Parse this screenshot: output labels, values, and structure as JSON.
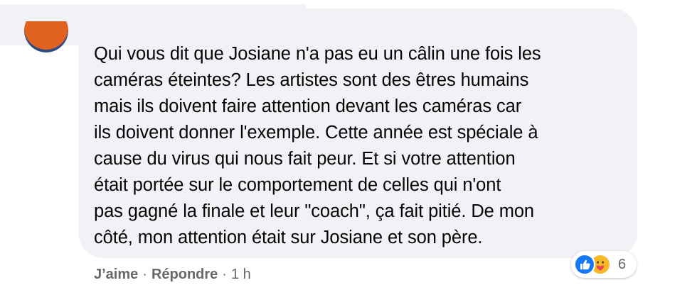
{
  "comment": {
    "text": "Qui vous dit que Josiane n'a pas eu un câlin une fois les\ncaméras éteintes? Les artistes sont des êtres humains\nmais ils doivent faire attention devant les caméras car\nils doivent donner l'exemple. Cette année est spéciale à\ncause du virus qui nous fait peur. Et si votre attention\nétait portée sur le comportement de celles qui n'ont\npas gagné la finale et leur \"coach\", ça fait pitié. De mon\ncôté, mon attention était sur Josiane et son père."
  },
  "actions": {
    "like_label": "J’aime",
    "separator": "·",
    "reply_label": "Répondre",
    "timestamp": "1 h"
  },
  "reactions": {
    "icons": [
      "like-icon",
      "care-icon"
    ],
    "count": "6"
  },
  "colors": {
    "bubble_bg": "#f0f2f5",
    "text": "#050505",
    "secondary_text": "#65676b",
    "like_blue": "#1877f2",
    "care_yellow": "#f7b928",
    "avatar_orange": "#e1621f"
  }
}
